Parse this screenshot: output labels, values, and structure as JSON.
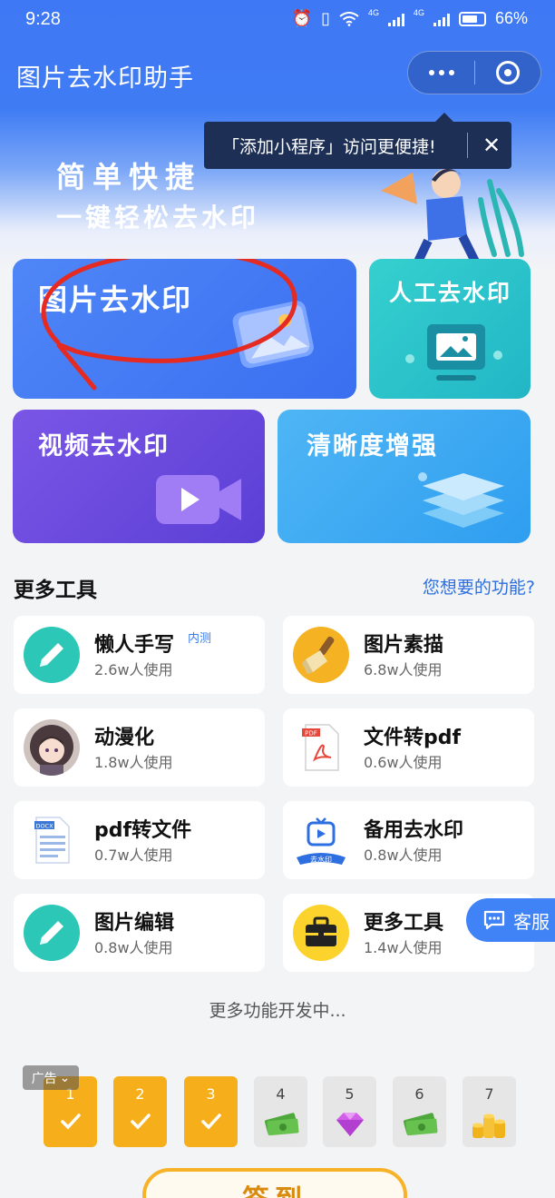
{
  "status_bar": {
    "time": "9:28",
    "network1": "4G",
    "network2": "4G",
    "battery": "66%"
  },
  "header": {
    "title": "图片去水印助手"
  },
  "tooltip": {
    "text": "「添加小程序」访问更便捷!",
    "close": "✕"
  },
  "hero": {
    "slogan_line1": "简单快捷",
    "slogan_line2": "一键轻松去水印"
  },
  "cards": {
    "image_watermark": "图片去水印",
    "manual_watermark": "人工去水印",
    "video_watermark": "视频去水印",
    "clarity_enhance": "清晰度增强"
  },
  "section": {
    "title": "更多工具",
    "link": "您想要的功能?"
  },
  "tools": [
    {
      "name": "懒人手写",
      "usage": "2.6w人使用",
      "badge": "内测",
      "icon": "pencil-icon"
    },
    {
      "name": "图片素描",
      "usage": "6.8w人使用",
      "icon": "brush-icon"
    },
    {
      "name": "动漫化",
      "usage": "1.8w人使用",
      "icon": "anime-avatar"
    },
    {
      "name": "文件转pdf",
      "usage": "0.6w人使用",
      "icon": "pdf-file-icon",
      "icon_text": "PDF"
    },
    {
      "name": "pdf转文件",
      "usage": "0.7w人使用",
      "icon": "docx-file-icon",
      "icon_text": "DOCX"
    },
    {
      "name": "备用去水印",
      "usage": "0.8w人使用",
      "icon": "tv-play-icon",
      "icon_text": "去水印"
    },
    {
      "name": "图片编辑",
      "usage": "0.8w人使用",
      "icon": "pencil-icon"
    },
    {
      "name": "更多工具",
      "usage": "1.4w人使用",
      "icon": "toolbox-icon"
    }
  ],
  "customer_service": {
    "label": "客服"
  },
  "footer_note": "更多功能开发中...",
  "checkin": {
    "ad_label": "广告",
    "days": [
      {
        "num": "1",
        "done": true
      },
      {
        "num": "2",
        "done": true
      },
      {
        "num": "3",
        "done": true
      },
      {
        "num": "4",
        "done": false,
        "reward": "cash-icon"
      },
      {
        "num": "5",
        "done": false,
        "reward": "gem-icon"
      },
      {
        "num": "6",
        "done": false,
        "reward": "cash-icon"
      },
      {
        "num": "7",
        "done": false,
        "reward": "coins-icon"
      }
    ],
    "button": "签到"
  },
  "colors": {
    "primary": "#3f78f4",
    "accent": "#f7ae1b",
    "link": "#2d6fe0"
  }
}
